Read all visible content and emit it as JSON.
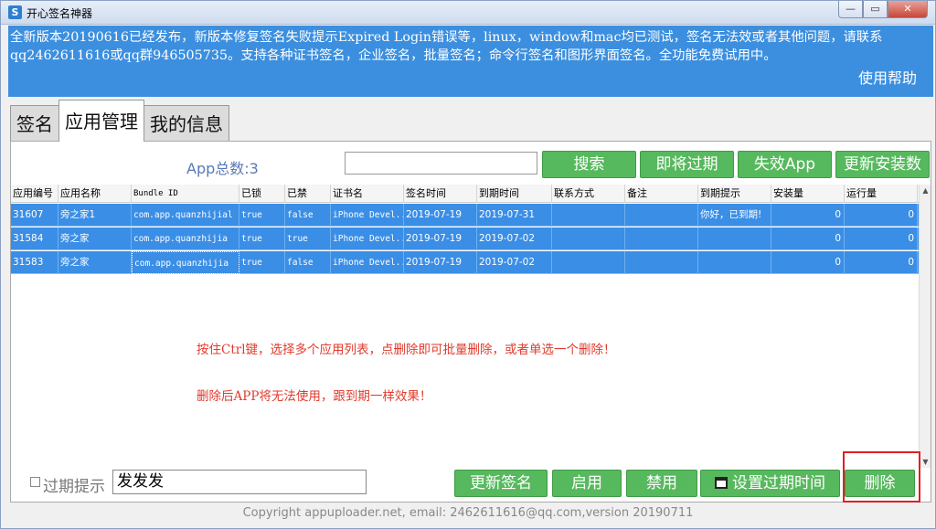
{
  "window": {
    "title": "开心签名神器",
    "controls": {
      "minimize": "—",
      "maximize": "▭",
      "close": "✕"
    }
  },
  "announcement": {
    "line1": "全新版本20190616已经发布，新版本修复签名失败提示Expired Login错误等，linux，window和mac均已测试，签名无法效或者其他问题，请联系",
    "line2": "qq2462611616或qq群946505735。支持各种证书签名，企业签名，批量签名；命令行签名和图形界面签名。全功能免费试用中。",
    "help": "使用帮助"
  },
  "tabs": [
    {
      "label": "签名",
      "active": false
    },
    {
      "label": "应用管理",
      "active": true
    },
    {
      "label": "我的信息",
      "active": false
    }
  ],
  "toolbar": {
    "count_label": "App总数:3",
    "search_value": "",
    "search_button": "搜索",
    "expiring_button": "即将过期",
    "invalid_button": "失效App",
    "update_installs_button": "更新安装数"
  },
  "table": {
    "columns": [
      "应用编号",
      "应用名称",
      "Bundle ID",
      "已锁",
      "已禁",
      "证书名",
      "签名时间",
      "到期时间",
      "联系方式",
      "备注",
      "到期提示",
      "安装量",
      "运行量"
    ],
    "rows": [
      [
        "31607",
        "旁之家1",
        "com.app.quanzhijial",
        "true",
        "false",
        "iPhone Devel...",
        "2019-07-19",
        "2019-07-31",
        "",
        "",
        "你好，已到期!",
        "0",
        "0"
      ],
      [
        "31584",
        "旁之家",
        "com.app.quanzhijia",
        "true",
        "true",
        "iPhone Devel...",
        "2019-07-19",
        "2019-07-02",
        "",
        "",
        "",
        "0",
        "0"
      ],
      [
        "31583",
        "旁之家",
        "com.app.quanzhijia",
        "true",
        "false",
        "iPhone Devel...",
        "2019-07-19",
        "2019-07-02",
        "",
        "",
        "",
        "0",
        "0"
      ]
    ]
  },
  "notes": {
    "line1": "按住Ctrl键，选择多个应用列表，点删除即可批量删除，或者单选一个删除！",
    "line2": "删除后APP将无法使用，跟到期一样效果！"
  },
  "bottom": {
    "expire_label": "过期提示",
    "expire_value": "发发发",
    "update_sign_button": "更新签名",
    "enable_button": "启用",
    "disable_button": "禁用",
    "set_expire_button": "设置过期时间",
    "delete_button": "删除"
  },
  "footer": "Copyright appuploader.net, email: 2462611616@qq.com,version 20190711",
  "colors": {
    "announce_bg": "#3c8fdf",
    "button_green": "#57b95e",
    "row_selected": "#3a8ee6",
    "note_red": "#e03b2c",
    "highlight_red": "#e02020"
  }
}
